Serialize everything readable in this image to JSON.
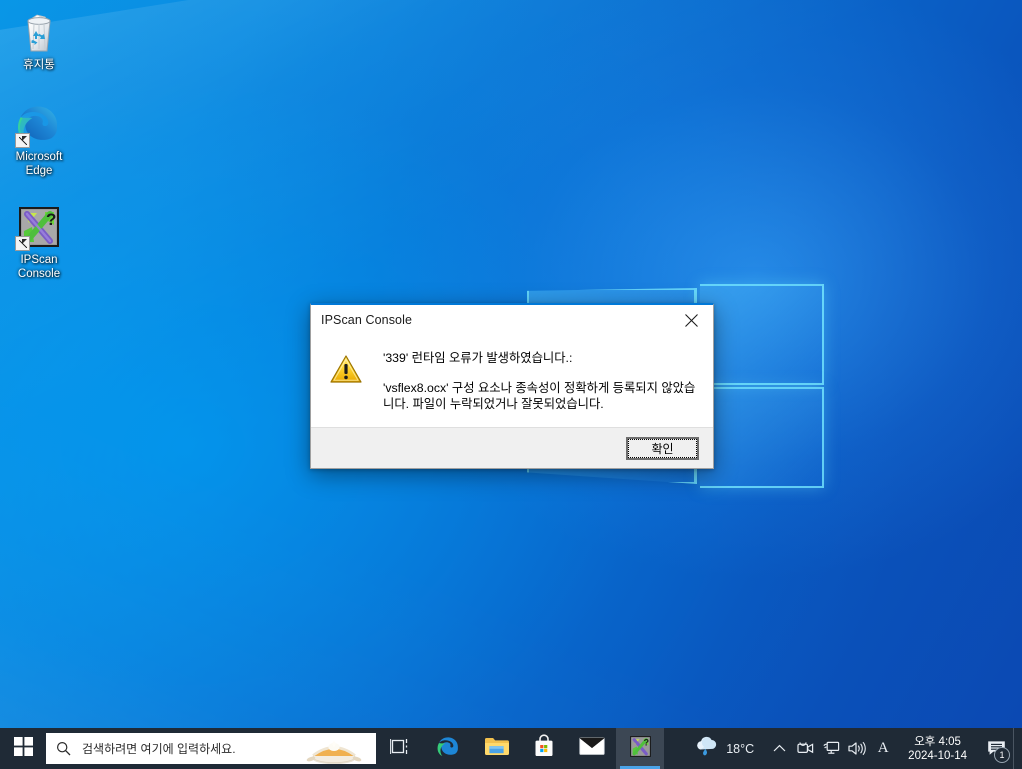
{
  "desktop": {
    "icons": [
      {
        "name": "recycle-bin",
        "label": "휴지통",
        "icon": "recycle-bin-icon",
        "shortcut": false
      },
      {
        "name": "microsoft-edge",
        "label": "Microsoft Edge",
        "icon": "edge-icon",
        "shortcut": true
      },
      {
        "name": "ipscan-console",
        "label": "IPScan Console",
        "icon": "ipscan-icon",
        "shortcut": true
      }
    ]
  },
  "dialog": {
    "title": "IPScan Console",
    "close_icon": "close-icon",
    "warning_icon": "warning-triangle-icon",
    "message_line1": "'339' 런타임 오류가 발생하였습니다.:",
    "message_line2": "'vsflex8.ocx' 구성 요소나 종속성이 정확하게 등록되지 않았습니다. 파일이 누락되었거나 잘못되었습니다.",
    "ok_label": "확인",
    "accent_color": "#0078d7",
    "footer_color": "#f0f0f0"
  },
  "taskbar": {
    "start_icon": "windows-start-icon",
    "search": {
      "icon": "search-icon",
      "placeholder": "검색하려면 여기에 입력하세요.",
      "value": "",
      "doodle_icon": "pumpkin-pie-icon"
    },
    "buttons": [
      {
        "name": "task-view",
        "icon": "task-view-icon",
        "label": "작업 보기",
        "active": false
      },
      {
        "name": "microsoft-edge",
        "icon": "edge-icon",
        "label": "Microsoft Edge",
        "active": false
      },
      {
        "name": "file-explorer",
        "icon": "folder-icon",
        "label": "파일 탐색기",
        "active": false
      },
      {
        "name": "microsoft-store",
        "icon": "store-bag-icon",
        "label": "Microsoft Store",
        "active": false
      },
      {
        "name": "mail",
        "icon": "mail-envelope-icon",
        "label": "메일",
        "active": false
      },
      {
        "name": "ipscan-console",
        "icon": "ipscan-icon",
        "label": "IPScan Console",
        "active": true
      }
    ],
    "weather": {
      "icon": "rain-cloud-icon",
      "temperature": "18°C"
    },
    "tray": [
      {
        "name": "show-hidden-icons",
        "icon": "chevron-up-icon"
      },
      {
        "name": "meet-now",
        "icon": "camera-icon"
      },
      {
        "name": "network",
        "icon": "network-monitor-icon"
      },
      {
        "name": "volume",
        "icon": "speaker-icon"
      },
      {
        "name": "input-indicator",
        "icon": "ime-a-icon",
        "label": "A"
      }
    ],
    "clock": {
      "time": "오후 4:05",
      "date": "2024-10-14"
    },
    "notifications": {
      "icon": "notification-icon",
      "count": "1"
    },
    "background_color": "#1f2a36"
  }
}
